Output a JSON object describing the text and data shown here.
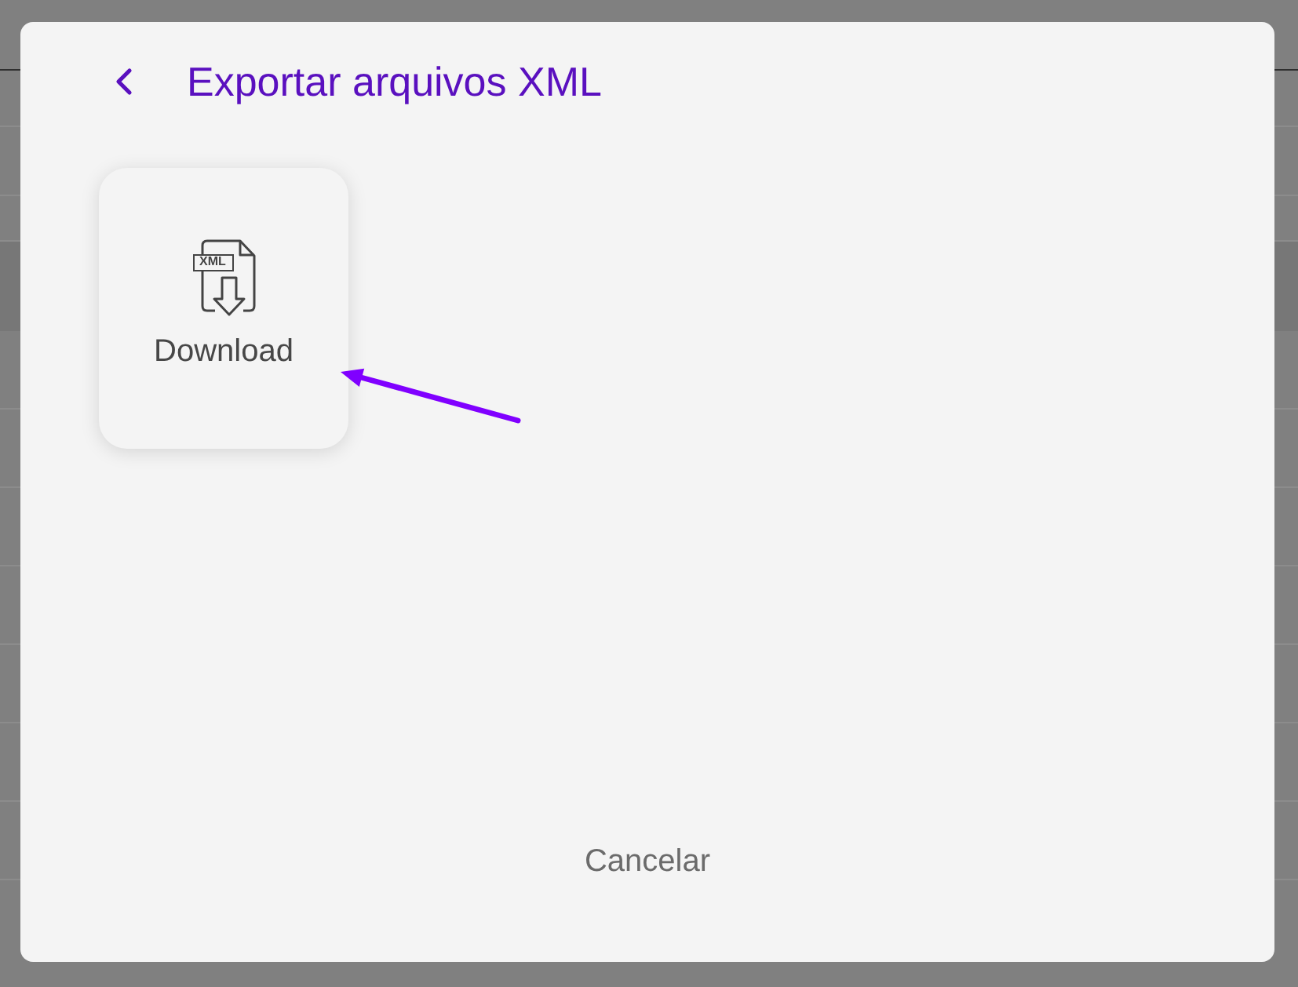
{
  "dialog": {
    "title": "Exportar arquivos XML",
    "options": [
      {
        "label": "Download",
        "file_tag": "XML"
      }
    ],
    "cancel_button": "Cancelar"
  }
}
